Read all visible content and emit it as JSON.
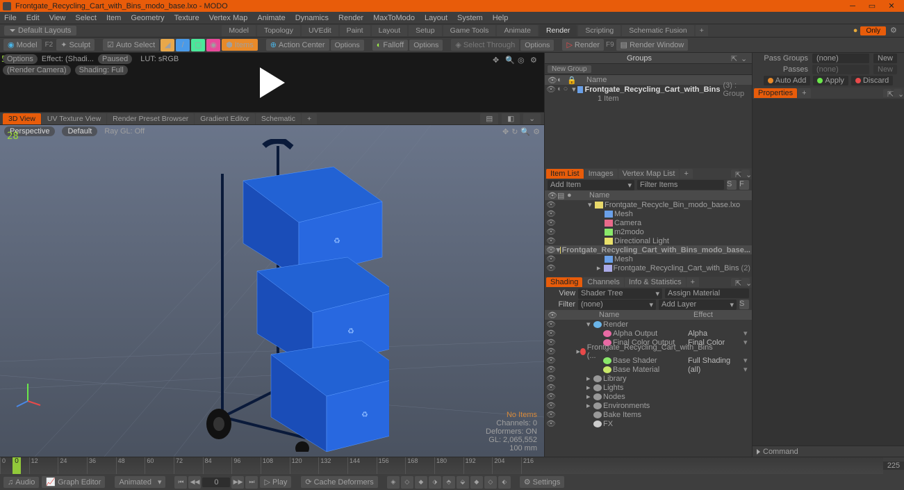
{
  "title": "Frontgate_Recycling_Cart_with_Bins_modo_base.lxo - MODO",
  "menus": [
    "File",
    "Edit",
    "View",
    "Select",
    "Item",
    "Geometry",
    "Texture",
    "Vertex Map",
    "Animate",
    "Dynamics",
    "Render",
    "MaxToModo",
    "Layout",
    "System",
    "Help"
  ],
  "layout_dropdown": "Default Layouts",
  "layout_tabs": [
    "Model",
    "Topology",
    "UVEdit",
    "Paint",
    "Layout",
    "Setup",
    "Game Tools",
    "Animate",
    "Render",
    "Scripting",
    "Schematic Fusion"
  ],
  "layout_active": "Render",
  "only_badge": "Only",
  "toolbar": {
    "model": "Model",
    "f2": "F2",
    "sculpt": "Sculpt",
    "autoselect": "Auto Select",
    "items": "Items",
    "action": "Action Center",
    "options1": "Options",
    "falloff": "Falloff",
    "options2": "Options",
    "select_through": "Select Through",
    "options3": "Options",
    "render": "Render",
    "open_rw": "Render Window"
  },
  "render_preview": {
    "badge": "5",
    "options": "Options",
    "effect": "Effect: (Shadi...",
    "paused": "Paused",
    "lut": "LUT: sRGB",
    "camera": "(Render Camera)",
    "shading": "Shading: Full"
  },
  "viewport_tabs": [
    "3D View",
    "UV Texture View",
    "Render Preset Browser",
    "Gradient Editor",
    "Schematic"
  ],
  "viewport_active": "3D View",
  "viewport": {
    "vnum": "28",
    "perspective": "Perspective",
    "default": "Default",
    "raygl": "Ray GL: Off",
    "stats": {
      "noitems": "No Items",
      "channels": "Channels: 0",
      "deformers": "Deformers: ON",
      "gl": "GL: 2,065,552",
      "unit": "100 mm"
    }
  },
  "groups": {
    "header": "Groups",
    "newgroup": "New Group",
    "col_eye": " ",
    "col_name": "Name",
    "item": "Frontgate_Recycling_Cart_with_Bins",
    "item_suffix": "(3) : Group",
    "sub": "1 Item"
  },
  "pass": {
    "label": "Pass Groups",
    "value": "(none)",
    "new": "New",
    "label2": "Passes",
    "value2": "(none)",
    "new2": "New"
  },
  "gad": {
    "autoadd": "Auto Add",
    "apply": "Apply",
    "discard": "Discard"
  },
  "props_header": "Properties",
  "itemlist": {
    "tabs": [
      "Item List",
      "Images",
      "Vertex Map List"
    ],
    "add": "Add Item",
    "filter": "Filter Items",
    "col_name": "Name",
    "rows": [
      {
        "indent": 0,
        "arrow": "▾",
        "icon": "scene",
        "text": "Frontgate_Recycle_Bin_modo_base.lxo"
      },
      {
        "indent": 1,
        "arrow": "",
        "icon": "mesh",
        "text": "Mesh"
      },
      {
        "indent": 1,
        "arrow": "",
        "icon": "cam",
        "text": "Camera"
      },
      {
        "indent": 1,
        "arrow": "",
        "icon": "m2m",
        "text": "m2modo"
      },
      {
        "indent": 1,
        "arrow": "",
        "icon": "light",
        "text": "Directional Light"
      },
      {
        "indent": 0,
        "arrow": "▾",
        "icon": "scene",
        "text": "Frontgate_Recycling_Cart_with_Bins_modo_base...",
        "bold": true,
        "selected": true
      },
      {
        "indent": 1,
        "arrow": "",
        "icon": "mesh",
        "text": "Mesh"
      },
      {
        "indent": 1,
        "arrow": "▸",
        "icon": "loc",
        "text": "Frontgate_Recycling_Cart_with_Bins",
        "suffix": "(2)"
      }
    ]
  },
  "shading": {
    "tabs": [
      "Shading",
      "Channels",
      "Info & Statistics"
    ],
    "view": "View",
    "view_val": "Shader Tree",
    "assign": "Assign Material",
    "filter": "Filter",
    "filter_val": "(none)",
    "addlayer": "Add Layer",
    "col_name": "Name",
    "col_effect": "Effect",
    "rows": [
      {
        "indent": 0,
        "arrow": "▾",
        "icon": "render",
        "text": "Render",
        "effect": ""
      },
      {
        "indent": 1,
        "arrow": "",
        "icon": "out",
        "text": "Alpha Output",
        "effect": "Alpha"
      },
      {
        "indent": 1,
        "arrow": "",
        "icon": "out",
        "text": "Final Color Output",
        "effect": "Final Color"
      },
      {
        "indent": 1,
        "arrow": "▸",
        "icon": "mat",
        "text": "Frontgate_Recycling_Cart_with_Bins (...",
        "effect": ""
      },
      {
        "indent": 1,
        "arrow": "",
        "icon": "shader",
        "text": "Base Shader",
        "effect": "Full Shading"
      },
      {
        "indent": 1,
        "arrow": "",
        "icon": "mat2",
        "text": "Base Material",
        "effect": "(all)"
      },
      {
        "indent": 0,
        "arrow": "▸",
        "icon": "fld",
        "text": "Library",
        "effect": ""
      },
      {
        "indent": 0,
        "arrow": "▸",
        "icon": "fld",
        "text": "Lights",
        "effect": ""
      },
      {
        "indent": 0,
        "arrow": "▸",
        "icon": "fld",
        "text": "Nodes",
        "effect": ""
      },
      {
        "indent": 0,
        "arrow": "▸",
        "icon": "fld",
        "text": "Environments",
        "effect": ""
      },
      {
        "indent": 0,
        "arrow": "",
        "icon": "fld",
        "text": "Bake Items",
        "effect": ""
      },
      {
        "indent": 0,
        "arrow": "",
        "icon": "fx",
        "text": "FX",
        "effect": ""
      }
    ]
  },
  "timeline_ticks": [
    0,
    12,
    24,
    36,
    48,
    60,
    72,
    84,
    96,
    108,
    120,
    132,
    144,
    156,
    168,
    180,
    192,
    204,
    216
  ],
  "timeline_end": "225",
  "playbar": {
    "audio": "Audio",
    "graph": "Graph Editor",
    "animated": "Animated",
    "frame": "0",
    "play": "Play",
    "cache": "Cache Deformers",
    "settings": "Settings"
  },
  "command": "Command"
}
